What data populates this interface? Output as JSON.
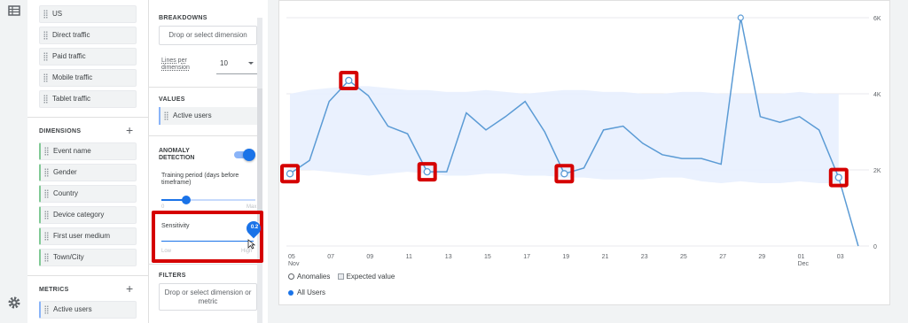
{
  "rail": {
    "top_icon": "table-icon",
    "bottom_icon": "gear-icon"
  },
  "variables": {
    "segments": [
      "US",
      "Direct traffic",
      "Paid traffic",
      "Mobile traffic",
      "Tablet traffic"
    ],
    "dimensions_title": "DIMENSIONS",
    "dimensions": [
      "Event name",
      "Gender",
      "Country",
      "Device category",
      "First user medium",
      "Town/City"
    ],
    "metrics_title": "METRICS",
    "metrics": [
      "Active users"
    ]
  },
  "settings": {
    "breakdowns_title": "BREAKDOWNS",
    "breakdowns_placeholder": "Drop or select dimension",
    "lines_label_1": "Lines per",
    "lines_label_2": "dimension",
    "lines_value": "10",
    "values_title": "VALUES",
    "value_chip": "Active users",
    "anomaly_title_1": "ANOMALY",
    "anomaly_title_2": "DETECTION",
    "anomaly_enabled": true,
    "training_label_1": "Training period (days before",
    "training_label_2": "timeframe)",
    "training_min": "0",
    "training_max": "Max",
    "sensitivity_label": "Sensitivity",
    "sensitivity_value": "0.2",
    "sensitivity_low": "Low",
    "sensitivity_high": "High",
    "filters_title": "FILTERS",
    "filters_placeholder_1": "Drop or select dimension or",
    "filters_placeholder_2": "metric"
  },
  "legend": {
    "anomalies": "Anomalies",
    "expected": "Expected value",
    "series": "All Users"
  },
  "colors": {
    "line": "#5b9bd5",
    "band": "#e8f0fe",
    "highlight": "#d50000",
    "accent": "#1a73e8"
  },
  "chart_data": {
    "type": "line",
    "x_ticks": [
      "05",
      "07",
      "09",
      "11",
      "13",
      "15",
      "17",
      "19",
      "21",
      "23",
      "25",
      "27",
      "29",
      "01",
      "03"
    ],
    "x_month_labels": [
      "Nov",
      "Dec"
    ],
    "y_ticks": [
      "6K",
      "4K",
      "2K",
      "0"
    ],
    "ylim": [
      0,
      6000
    ],
    "series": [
      {
        "name": "All Users",
        "x": [
          "Nov 5",
          "Nov 6",
          "Nov 7",
          "Nov 8",
          "Nov 9",
          "Nov 10",
          "Nov 11",
          "Nov 12",
          "Nov 13",
          "Nov 14",
          "Nov 15",
          "Nov 16",
          "Nov 17",
          "Nov 18",
          "Nov 19",
          "Nov 20",
          "Nov 21",
          "Nov 22",
          "Nov 23",
          "Nov 24",
          "Nov 25",
          "Nov 26",
          "Nov 27",
          "Nov 28",
          "Nov 29",
          "Nov 30",
          "Dec 1",
          "Dec 2",
          "Dec 3",
          "Dec 4"
        ],
        "values": [
          1900,
          2250,
          3800,
          4350,
          3950,
          3150,
          2950,
          1950,
          1950,
          3500,
          3050,
          3400,
          3800,
          3000,
          1900,
          2050,
          3050,
          3150,
          2700,
          2400,
          2300,
          2300,
          2150,
          6000,
          3400,
          3250,
          3400,
          3050,
          1800,
          0
        ]
      }
    ],
    "expected_band": {
      "upper": [
        4000,
        4100,
        4150,
        4200,
        4200,
        4150,
        4100,
        4100,
        4050,
        4050,
        4100,
        4050,
        4000,
        4050,
        4100,
        4100,
        4050,
        4050,
        4000,
        4000,
        4050,
        4050,
        4000,
        4000,
        4000,
        4000,
        4050,
        4000,
        4000
      ],
      "lower": [
        2000,
        2000,
        1950,
        1900,
        1850,
        1900,
        1950,
        1900,
        1850,
        1850,
        1900,
        1900,
        1850,
        1850,
        1800,
        1800,
        1750,
        1750,
        1750,
        1800,
        1800,
        1700,
        1650,
        1700,
        1650,
        1650,
        1700,
        1650,
        1650
      ]
    },
    "anomalies": [
      "Nov 5",
      "Nov 8",
      "Nov 12",
      "Nov 19",
      "Dec 3"
    ],
    "anomaly_values": [
      1900,
      4350,
      1950,
      1900,
      1800
    ]
  }
}
